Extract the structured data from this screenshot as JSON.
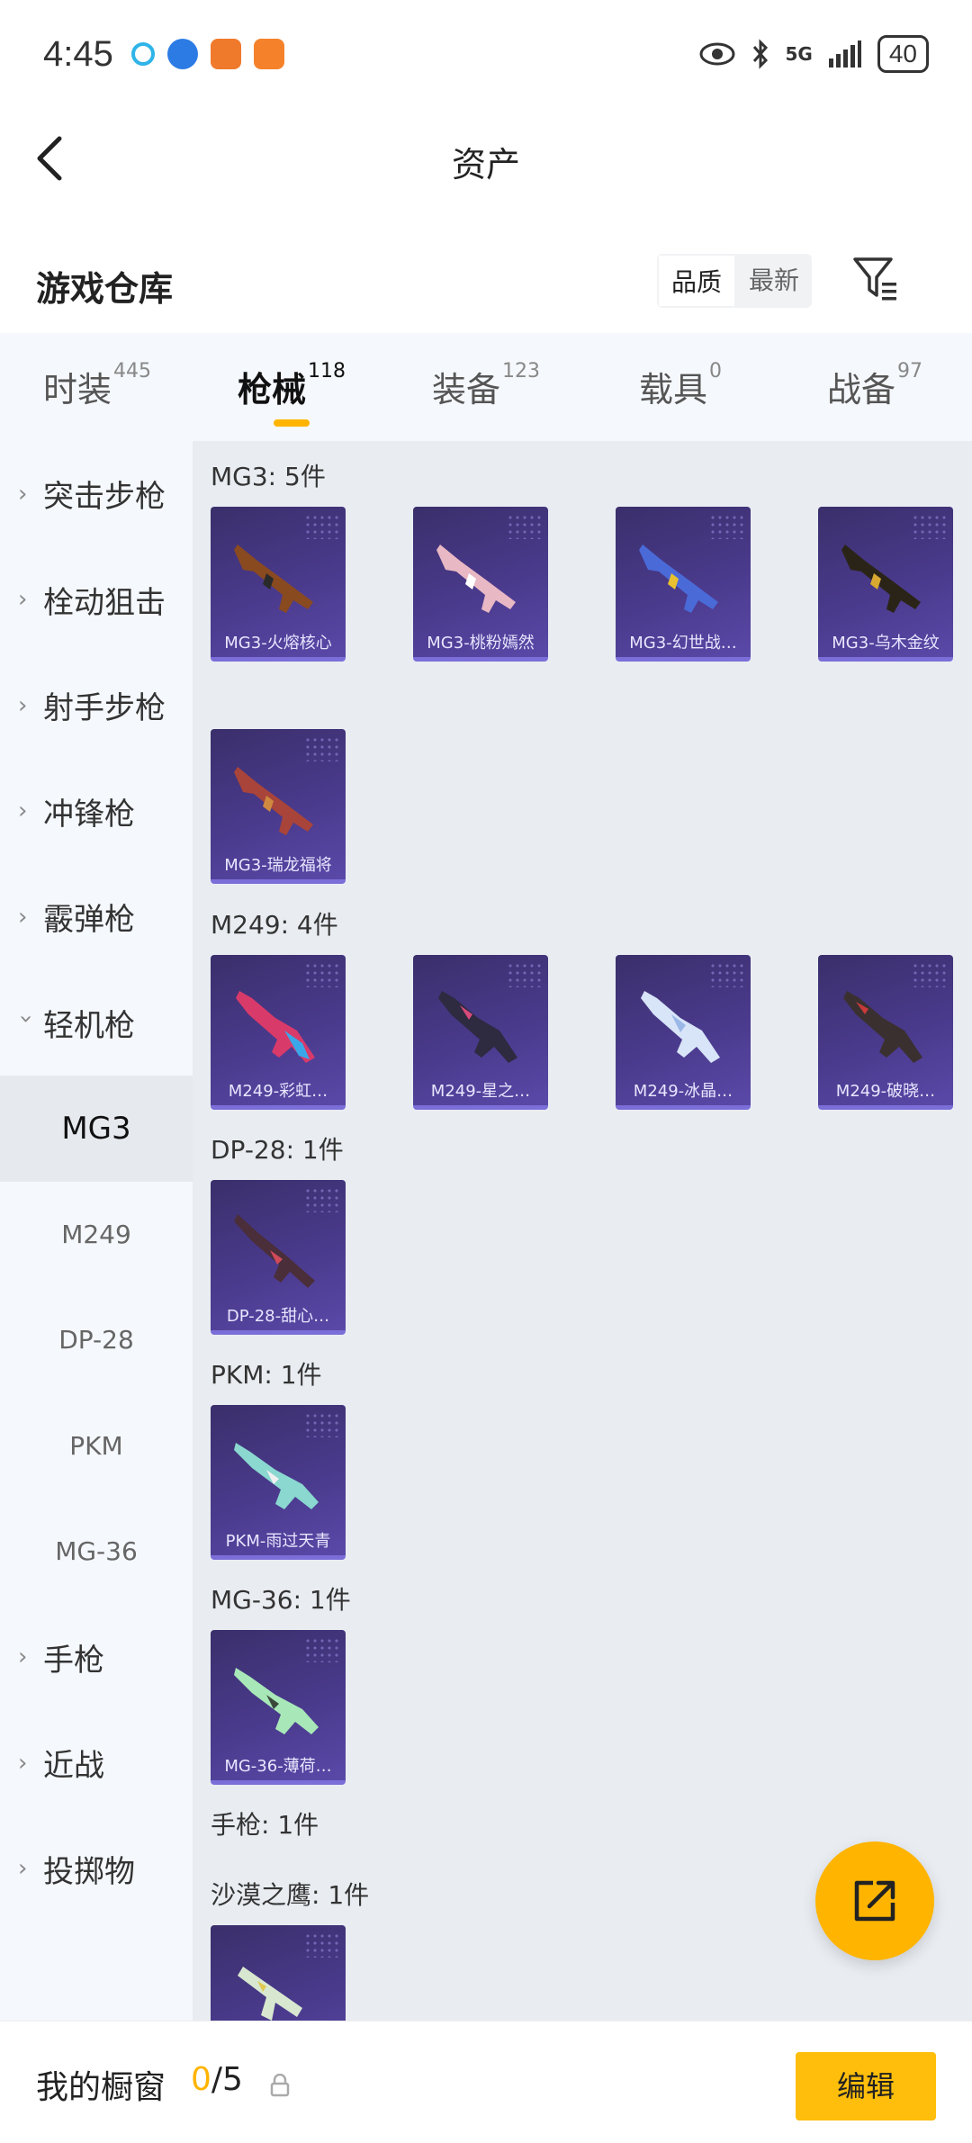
{
  "status_bar": {
    "time": "4:45",
    "network": "5G",
    "battery": "40"
  },
  "nav": {
    "title": "资产"
  },
  "warehouse": {
    "title": "游戏仓库",
    "sort_options": [
      "品质",
      "最新"
    ],
    "selected_sort": "品质"
  },
  "tabs": [
    {
      "label": "时装",
      "count": "445"
    },
    {
      "label": "枪械",
      "count": "118",
      "active": true
    },
    {
      "label": "装备",
      "count": "123"
    },
    {
      "label": "载具",
      "count": "0"
    },
    {
      "label": "战备",
      "count": "97"
    }
  ],
  "sidebar": {
    "categories": [
      "突击步枪",
      "栓动狙击",
      "射手步枪",
      "冲锋枪",
      "霰弹枪",
      "轻机枪"
    ],
    "expanded": "轻机枪",
    "subitems": [
      "MG3",
      "M249",
      "DP-28",
      "PKM",
      "MG-36"
    ],
    "selected_sub": "MG3",
    "more": [
      "手枪",
      "近战",
      "投掷物"
    ]
  },
  "content": {
    "groups": [
      {
        "title": "MG3: 5件",
        "items": [
          "MG3-火熔核心",
          "MG3-桃粉嫣然",
          "MG3-幻世战…",
          "MG3-乌木金纹",
          "MG3-瑞龙福将"
        ]
      },
      {
        "title": "M249: 4件",
        "items": [
          "M249-彩虹…",
          "M249-星之…",
          "M249-冰晶…",
          "M249-破晓…"
        ]
      },
      {
        "title": "DP-28: 1件",
        "items": [
          "DP-28-甜心…"
        ]
      },
      {
        "title": "PKM: 1件",
        "items": [
          "PKM-雨过天青"
        ]
      },
      {
        "title": "MG-36: 1件",
        "items": [
          "MG-36-薄荷…"
        ]
      },
      {
        "title": "手枪: 1件",
        "items": []
      },
      {
        "title": "沙漠之鹰: 1件",
        "items": [
          ""
        ]
      }
    ]
  },
  "bottom_bar": {
    "label": "我的橱窗",
    "current": "0",
    "total": "/5",
    "edit_label": "编辑"
  },
  "colors": {
    "accent": "#ffb400",
    "card_bg": "#4a3a8c",
    "content_bg": "#e9edf2",
    "sidebar_bg": "#f5f8fc"
  }
}
